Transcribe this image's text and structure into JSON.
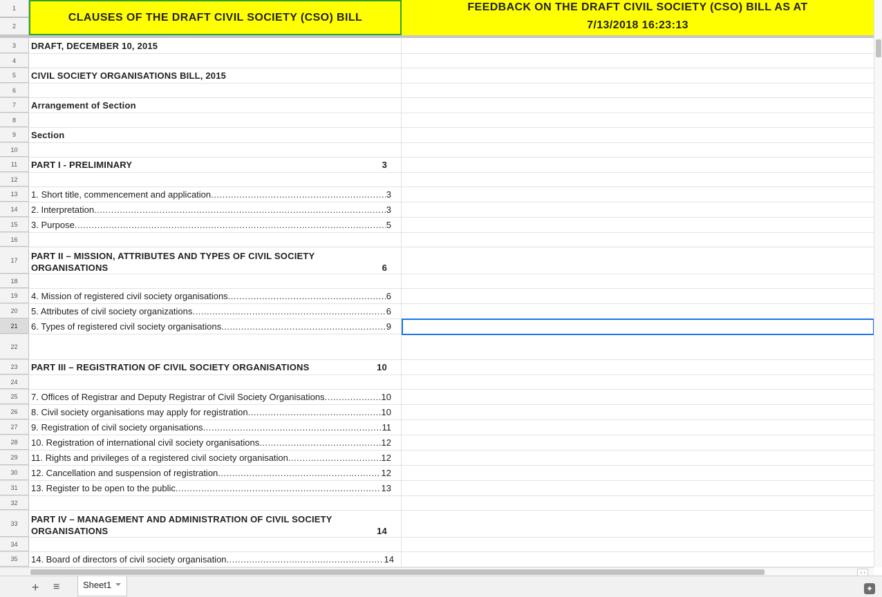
{
  "header": {
    "title_left": "CLAUSES OF THE DRAFT CIVIL SOCIETY (CSO) BILL",
    "title_right_line1": "FEEDBACK ON THE DRAFT CIVIL SOCIETY (CSO) BILL AS AT",
    "title_right_line2": "7/13/2018 16:23:13"
  },
  "row_numbers": [
    "1",
    "2",
    "3",
    "4",
    "5",
    "6",
    "7",
    "8",
    "9",
    "10",
    "11",
    "12",
    "13",
    "14",
    "15",
    "16",
    "17",
    "18",
    "19",
    "20",
    "21",
    "22",
    "23",
    "24",
    "25",
    "26",
    "27",
    "28",
    "29",
    "30",
    "31",
    "32",
    "33",
    "34",
    "35"
  ],
  "headings": {
    "draft": "DRAFT, DECEMBER 10, 2015",
    "bill": "CIVIL SOCIETY ORGANISATIONS BILL, 2015",
    "arrangement": "Arrangement of Section",
    "section": "Section"
  },
  "parts": [
    {
      "label": "PART I - PRELIMINARY",
      "page": "3"
    },
    {
      "line1": "PART II – MISSION, ATTRIBUTES AND TYPES OF CIVIL SOCIETY",
      "line2": "ORGANISATIONS",
      "page": "6"
    },
    {
      "label": "PART III – REGISTRATION OF CIVIL SOCIETY ORGANISATIONS",
      "page": "10"
    },
    {
      "line1": "PART IV – MANAGEMENT AND ADMINISTRATION OF CIVIL SOCIETY",
      "line2": "ORGANISATIONS",
      "page": "14"
    }
  ],
  "entries": [
    {
      "text": "1. Short title, commencement and application",
      "page": "3"
    },
    {
      "text": "2. Interpretation",
      "page": "3"
    },
    {
      "text": "3. Purpose",
      "page": "5"
    },
    {
      "text": "4. Mission of registered civil society organisations",
      "page": "6"
    },
    {
      "text": "5. Attributes of civil society organizations",
      "page": "6"
    },
    {
      "text": "6. Types of registered civil society organisations",
      "page": "9"
    },
    {
      "text": "7. Offices of Registrar and Deputy Registrar of Civil Society Organisations",
      "page": "10"
    },
    {
      "text": "8. Civil society organisations may apply for registration",
      "page": "10"
    },
    {
      "text": "9. Registration of civil society organisations",
      "page": "11"
    },
    {
      "text": "10. Registration of international civil society organisations",
      "page": "12"
    },
    {
      "text": "11. Rights and privileges of a registered civil society organisation",
      "page": "12"
    },
    {
      "text": "12. Cancellation and suspension of registration",
      "page": "12"
    },
    {
      "text": "13. Register to be open to the public",
      "page": "13"
    },
    {
      "text": "14. Board of directors of civil society organisation",
      "page": "14"
    }
  ],
  "leader_dots": "..............................................................................................................................",
  "sheet_tab": {
    "label": "Sheet1"
  },
  "icons": {
    "add": "+",
    "all_sheets": "≡",
    "explore": "✦",
    "scroll_arrows": "‹ ›"
  }
}
